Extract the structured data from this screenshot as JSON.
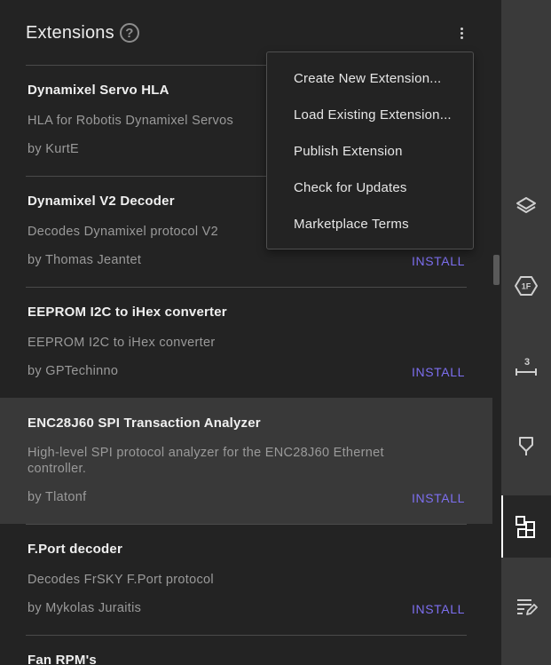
{
  "header": {
    "title": "Extensions",
    "help_glyph": "?"
  },
  "menu": {
    "items": [
      "Create New Extension...",
      "Load Existing Extension...",
      "Publish Extension",
      "Check for Updates",
      "Marketplace Terms"
    ]
  },
  "extensions": [
    {
      "name": "Dynamixel Servo HLA",
      "desc": "HLA for Robotis Dynamixel Servos",
      "author": "by KurtE",
      "action": ""
    },
    {
      "name": "Dynamixel V2 Decoder",
      "desc": "Decodes Dynamixel protocol V2",
      "author": "by Thomas Jeantet",
      "action": "INSTALL"
    },
    {
      "name": "EEPROM I2C to iHex converter",
      "desc": "EEPROM I2C to iHex converter",
      "author": "by GPTechinno",
      "action": "INSTALL"
    },
    {
      "name": "ENC28J60 SPI Transaction Analyzer",
      "desc": "High-level SPI protocol analyzer for the ENC28J60 Ethernet controller.",
      "author": "by Tlatonf",
      "action": "INSTALL"
    },
    {
      "name": "F.Port decoder",
      "desc": "Decodes FrSKY F.Port protocol",
      "author": "by Mykolas Juraitis",
      "action": "INSTALL"
    },
    {
      "name": "Fan RPM's",
      "desc": "",
      "author": "",
      "action": ""
    }
  ],
  "rail": {
    "items": [
      {
        "icon": "layers-icon"
      },
      {
        "icon": "hex-value-icon",
        "glyph": "1F"
      },
      {
        "icon": "measure-icon",
        "glyph": "3"
      },
      {
        "icon": "marker-icon"
      },
      {
        "icon": "extensions-icon",
        "active": true
      },
      {
        "icon": "notes-icon"
      }
    ]
  },
  "colors": {
    "accent": "#7d6ff0",
    "background": "#232323",
    "rail": "#3a3a3a",
    "highlight": "#393939"
  }
}
